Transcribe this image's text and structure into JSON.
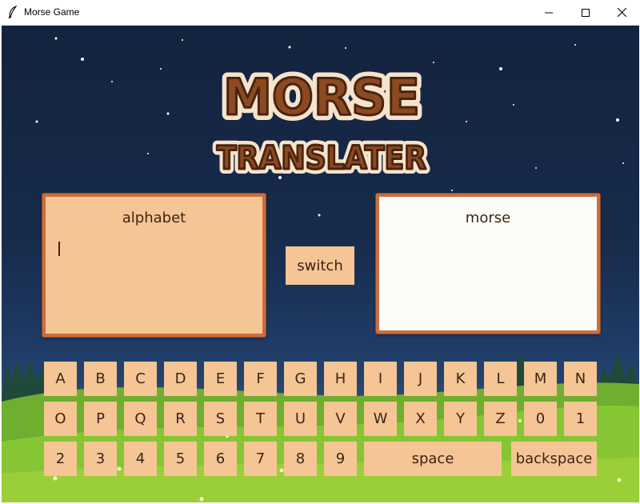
{
  "window": {
    "title": "Morse Game",
    "minimize_icon": "minimize-icon",
    "maximize_icon": "maximize-icon",
    "close_icon": "close-icon"
  },
  "logo": {
    "line1": "MORSE",
    "line2": "TRANSLATER"
  },
  "input_panel": {
    "title": "alphabet",
    "value": ""
  },
  "output_panel": {
    "title": "morse",
    "value": ""
  },
  "switch_button": {
    "label": "switch"
  },
  "keyboard": {
    "rows": [
      [
        "A",
        "B",
        "C",
        "D",
        "E",
        "F",
        "G",
        "H",
        "I",
        "J",
        "K",
        "L",
        "M",
        "N"
      ],
      [
        "O",
        "P",
        "Q",
        "R",
        "S",
        "T",
        "U",
        "V",
        "W",
        "X",
        "Y",
        "Z",
        "0",
        "1"
      ],
      [
        "2",
        "3",
        "4",
        "5",
        "6",
        "7",
        "8",
        "9"
      ]
    ],
    "space_label": "space",
    "backspace_label": "backspace"
  },
  "colors": {
    "key_fill": "#f5c595",
    "key_text": "#3e2414",
    "panel_border": "#c96e3d",
    "night_sky": "#172b4b",
    "grass": "#8fcf3a"
  }
}
